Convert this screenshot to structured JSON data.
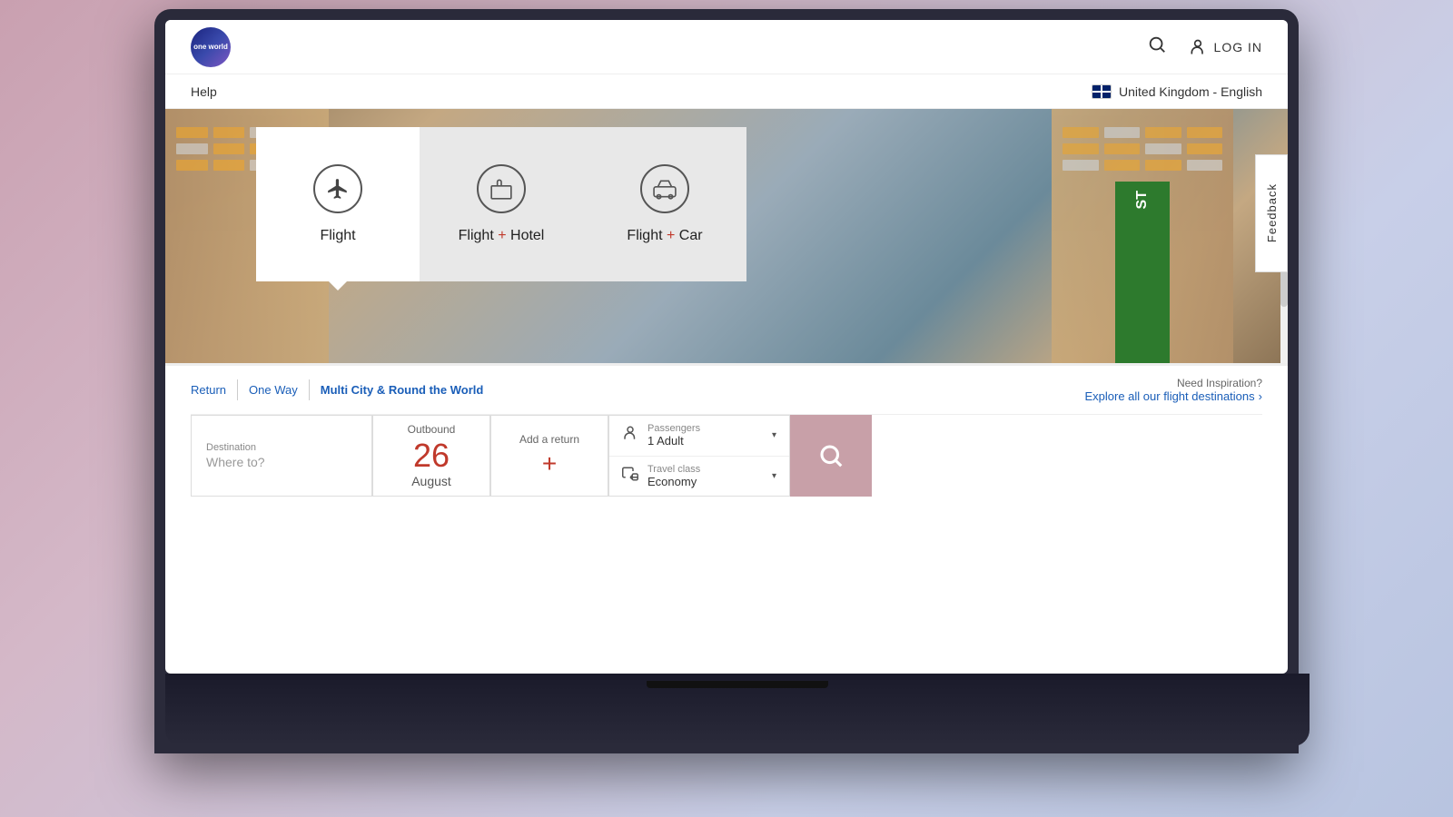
{
  "app": {
    "logo_text": "one\nworld",
    "search_icon": "🔍",
    "login_label": "LOG IN",
    "help_label": "Help",
    "locale_label": "United Kingdom - English",
    "feedback_label": "Feedback"
  },
  "tabs": [
    {
      "id": "flight",
      "label": "Flight",
      "icon": "✈",
      "active": true
    },
    {
      "id": "flight-hotel",
      "label_prefix": "Flight",
      "label_plus": " + ",
      "label_suffix": "Hotel",
      "icon": "🛏",
      "active": false
    },
    {
      "id": "flight-car",
      "label_prefix": "Flight",
      "label_plus": " + ",
      "label_suffix": "Car",
      "icon": "🚗",
      "active": false
    }
  ],
  "subnav": {
    "links": [
      {
        "label": "Return",
        "active": false
      },
      {
        "label": "One Way",
        "active": false
      },
      {
        "label": "Multi City & Round the World",
        "active": true
      }
    ],
    "inspiration_label": "Need Inspiration?",
    "explore_label": "Explore all our flight destinations",
    "explore_arrow": "›"
  },
  "search": {
    "outbound": {
      "label": "Outbound",
      "day": "26",
      "month": "August"
    },
    "return": {
      "label": "Add a return",
      "plus": "+"
    },
    "passengers": {
      "label": "Passengers",
      "value": "1 Adult",
      "arrow": "▾"
    },
    "travel_class": {
      "label": "Travel class",
      "value": "Economy",
      "arrow": "▾"
    },
    "search_button_icon": "🔍"
  },
  "street_sign_text": "ST"
}
